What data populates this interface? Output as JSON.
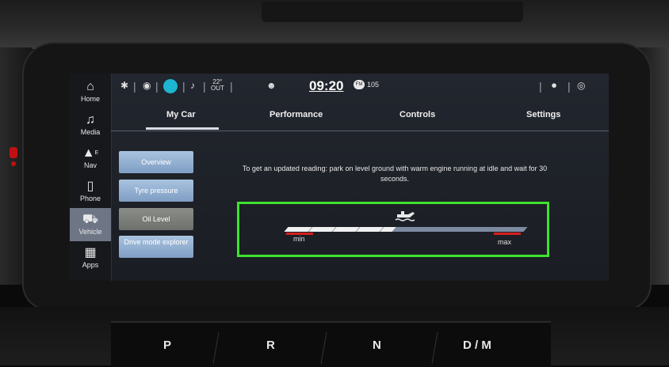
{
  "nav": {
    "items": [
      {
        "label": "Home",
        "icon": "home-icon",
        "glyph": "⌂"
      },
      {
        "label": "Media",
        "icon": "music-note-icon",
        "glyph": "♫"
      },
      {
        "label": "Nav",
        "icon": "navigation-arrow-icon",
        "glyph": "▲",
        "badge": "E"
      },
      {
        "label": "Phone",
        "icon": "phone-icon",
        "glyph": "▯"
      },
      {
        "label": "Vehicle",
        "icon": "car-icon",
        "glyph": "⛟"
      },
      {
        "label": "Apps",
        "icon": "apps-grid-icon",
        "glyph": "▦"
      }
    ],
    "active": "Vehicle"
  },
  "status_bar": {
    "temperature": "22°",
    "temperature_label": "OUT",
    "time": "09:20",
    "radio": "105",
    "radio_band": "FM"
  },
  "tabs": {
    "items": [
      "My Car",
      "Performance",
      "Controls",
      "Settings"
    ],
    "active": "My Car"
  },
  "sub_menu": {
    "items": [
      "Overview",
      "Tyre pressure",
      "Oil Level",
      "Drive mode explorer"
    ],
    "active": "Oil Level"
  },
  "oil_level": {
    "instruction": "To get an updated reading: park on level ground with warm engine running at idle and wait for 30 seconds.",
    "min_label": "min",
    "max_label": "max",
    "fill_fraction": 0.45,
    "segments_filled": 5
  },
  "gear_selector": {
    "gears": [
      "P",
      "R",
      "N",
      "D / M"
    ]
  },
  "colors": {
    "highlight": "#3ee22e",
    "limit_marker": "#d42020",
    "active_button": "#7f9ec4"
  }
}
